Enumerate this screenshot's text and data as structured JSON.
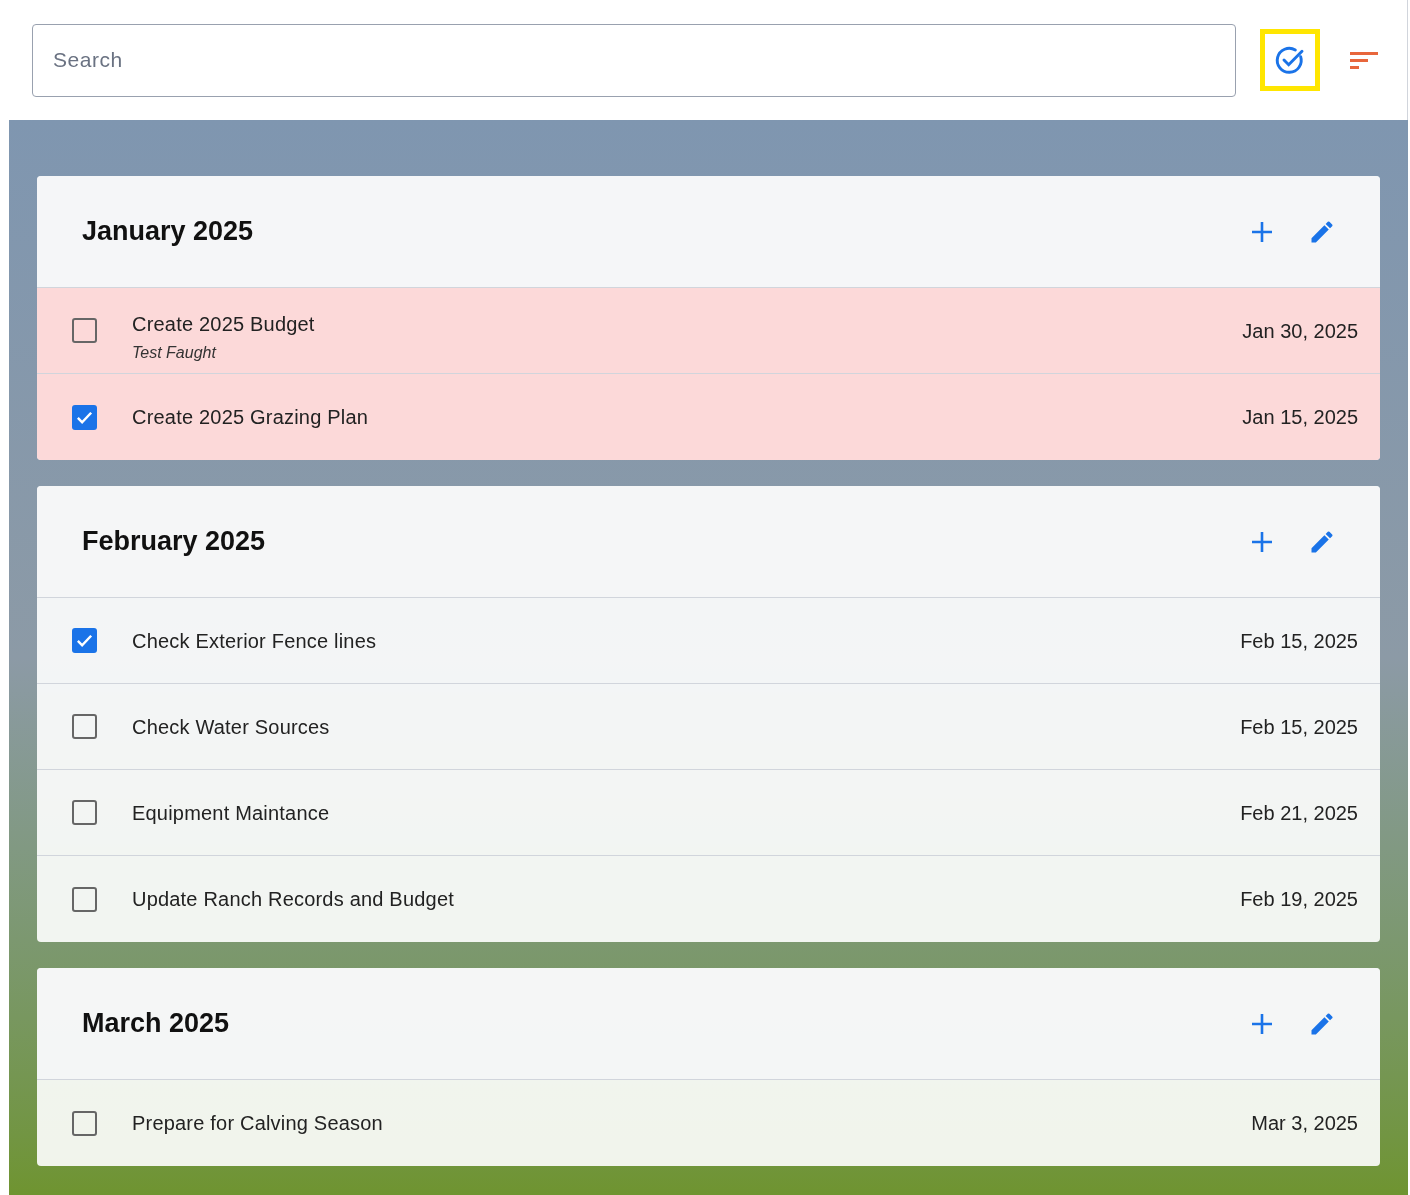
{
  "search": {
    "placeholder": "Search"
  },
  "toolbar": {
    "show_completed": {
      "highlighted": true
    }
  },
  "months": [
    {
      "title": "January 2025",
      "tasks": [
        {
          "title": "Create 2025 Budget",
          "note": "Test Faught",
          "date": "Jan 30, 2025",
          "checked": false,
          "overdue": true
        },
        {
          "title": "Create 2025 Grazing Plan",
          "date": "Jan 15, 2025",
          "checked": true,
          "overdue": true
        }
      ]
    },
    {
      "title": "February 2025",
      "tasks": [
        {
          "title": "Check Exterior Fence lines",
          "date": "Feb 15, 2025",
          "checked": true,
          "overdue": false
        },
        {
          "title": "Check Water Sources",
          "date": "Feb 15, 2025",
          "checked": false,
          "overdue": false
        },
        {
          "title": "Equipment Maintance",
          "date": "Feb 21, 2025",
          "checked": false,
          "overdue": false
        },
        {
          "title": "Update Ranch Records and Budget",
          "date": "Feb 19, 2025",
          "checked": false,
          "overdue": false
        }
      ]
    },
    {
      "title": "March 2025",
      "tasks": [
        {
          "title": "Prepare for Calving Season",
          "date": "Mar 3, 2025",
          "checked": false,
          "overdue": false
        }
      ]
    }
  ]
}
